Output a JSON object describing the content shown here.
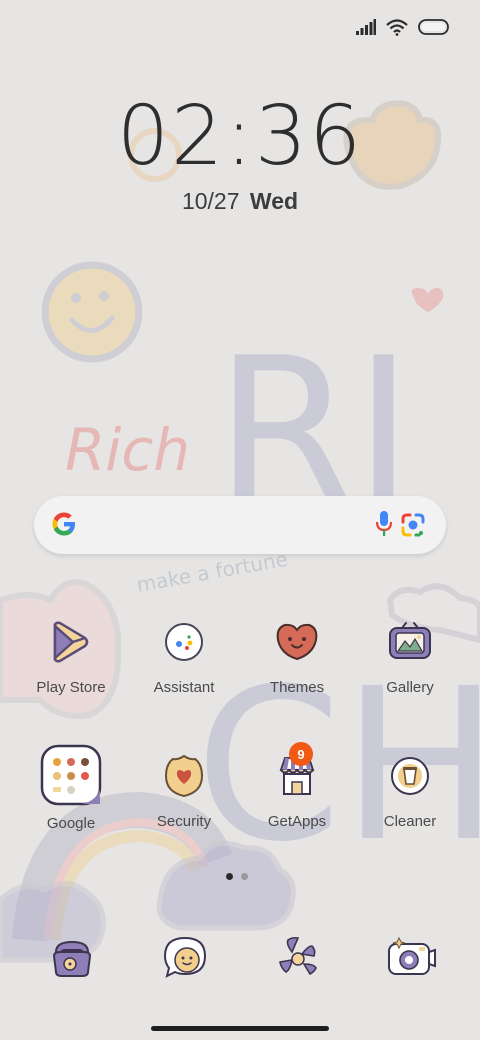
{
  "lockscreen": {
    "time": "02:36",
    "date": "10/27",
    "weekday": "Wed"
  },
  "wallpaper": {
    "text_rich": "Rich",
    "text_fortune": "make a fortune",
    "big_letters_top": "RI",
    "big_letters_bottom": "CH"
  },
  "status_bar": {
    "icons": [
      "signal-icon",
      "wifi-icon",
      "battery-icon"
    ]
  },
  "search": {
    "icons": [
      "google-g-icon",
      "microphone-icon",
      "google-lens-icon"
    ]
  },
  "apps_row1": [
    {
      "label": "Play Store",
      "icon": "play-store-icon"
    },
    {
      "label": "Assistant",
      "icon": "assistant-icon"
    },
    {
      "label": "Themes",
      "icon": "themes-icon"
    },
    {
      "label": "Gallery",
      "icon": "gallery-icon"
    }
  ],
  "apps_row2": [
    {
      "label": "Google",
      "icon": "google-folder-icon"
    },
    {
      "label": "Security",
      "icon": "security-icon"
    },
    {
      "label": "GetApps",
      "icon": "getapps-icon",
      "badge": "9"
    },
    {
      "label": "Cleaner",
      "icon": "cleaner-icon"
    }
  ],
  "page_indicator": {
    "total": 2,
    "active": 1
  },
  "dock": [
    {
      "icon": "phone-icon"
    },
    {
      "icon": "messages-icon"
    },
    {
      "icon": "browser-icon"
    },
    {
      "icon": "camera-icon"
    }
  ],
  "colors": {
    "background": "#e6e5e4",
    "accent_purple": "#8b7db5",
    "badge": "#f05a14",
    "text": "#4a4a4a"
  }
}
